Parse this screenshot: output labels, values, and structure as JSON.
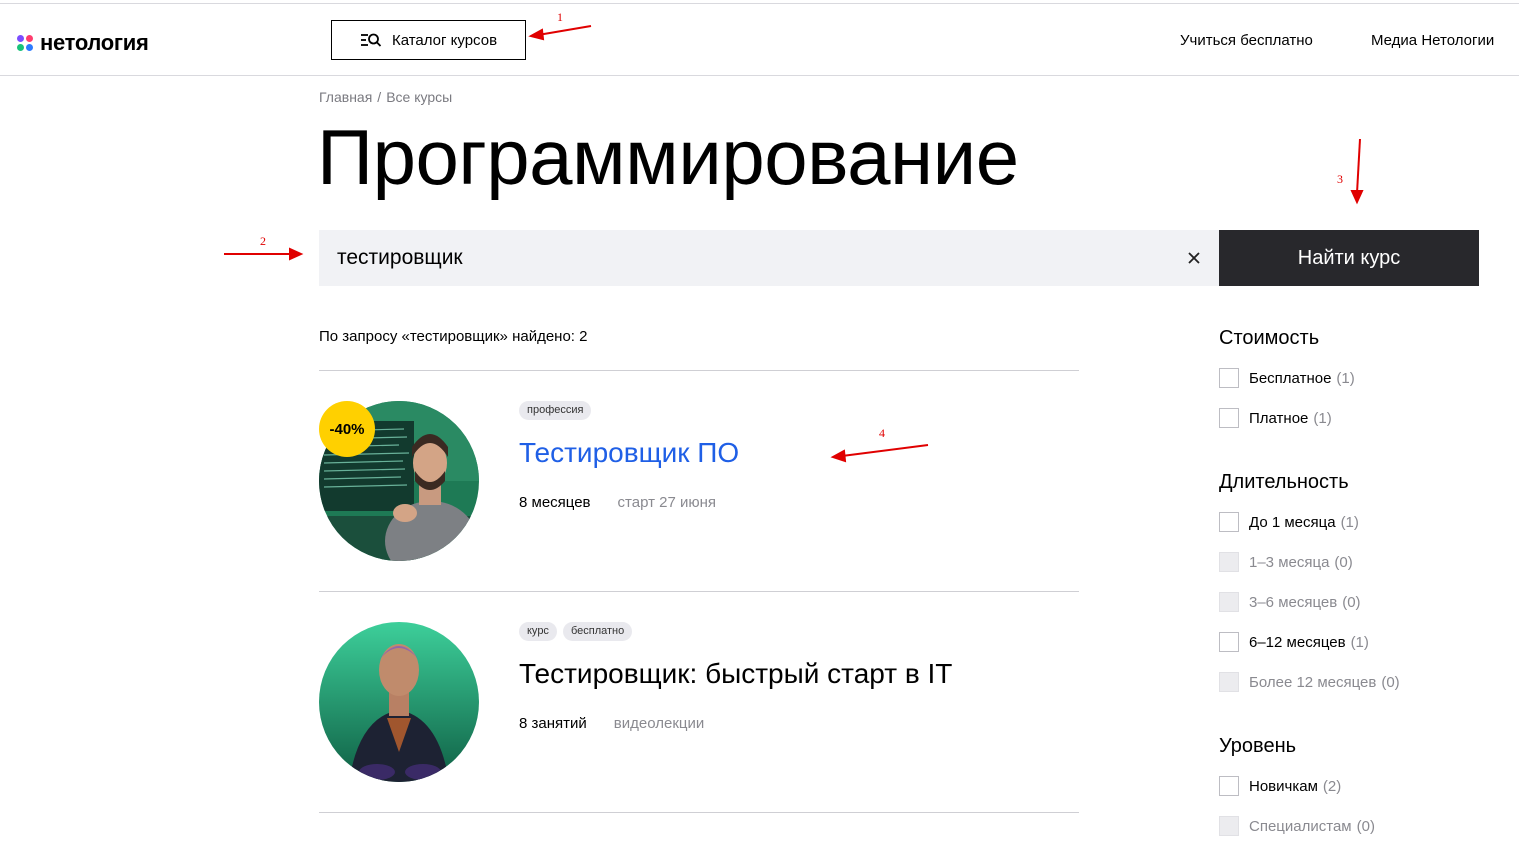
{
  "header": {
    "logo_text": "нетология",
    "catalog_button": "Каталог курсов",
    "nav": [
      "Учиться бесплатно",
      "Медиа Нетологии"
    ]
  },
  "breadcrumb": [
    "Главная",
    "/",
    "Все курсы"
  ],
  "page_title": "Программирование",
  "search": {
    "value": "тестировщик",
    "button_label": "Найти курс"
  },
  "results_text": "По запросу «тестировщик» найдено: 2",
  "courses": [
    {
      "discount": "-40%",
      "tags": [
        "профессия"
      ],
      "title": "Тестировщик ПО",
      "duration": "8 месяцев",
      "start": "старт 27 июня"
    },
    {
      "tags": [
        "курс",
        "бесплатно"
      ],
      "title": "Тестировщик: быстрый старт в IT",
      "duration": "8 занятий",
      "format": "видеолекции"
    }
  ],
  "filters": {
    "cost": {
      "title": "Стоимость",
      "options": [
        {
          "label": "Бесплатное",
          "count": "(1)"
        },
        {
          "label": "Платное",
          "count": "(1)"
        }
      ]
    },
    "duration": {
      "title": "Длительность",
      "options": [
        {
          "label": "До 1 месяца",
          "count": "(1)"
        },
        {
          "label": "1–3 месяца",
          "count": "(0)"
        },
        {
          "label": "3–6 месяцев",
          "count": "(0)"
        },
        {
          "label": "6–12 месяцев",
          "count": "(1)"
        },
        {
          "label": "Более 12 месяцев",
          "count": "(0)"
        }
      ]
    },
    "level": {
      "title": "Уровень",
      "options": [
        {
          "label": "Новичкам",
          "count": "(2)"
        },
        {
          "label": "Специалистам",
          "count": "(0)"
        }
      ]
    }
  },
  "annotations": [
    "1",
    "2",
    "3",
    "4"
  ],
  "colors": {
    "accent_link": "#1f5fe6",
    "dark_button": "#28282c",
    "discount_badge": "#ffd000",
    "annotation": "#e00000"
  }
}
